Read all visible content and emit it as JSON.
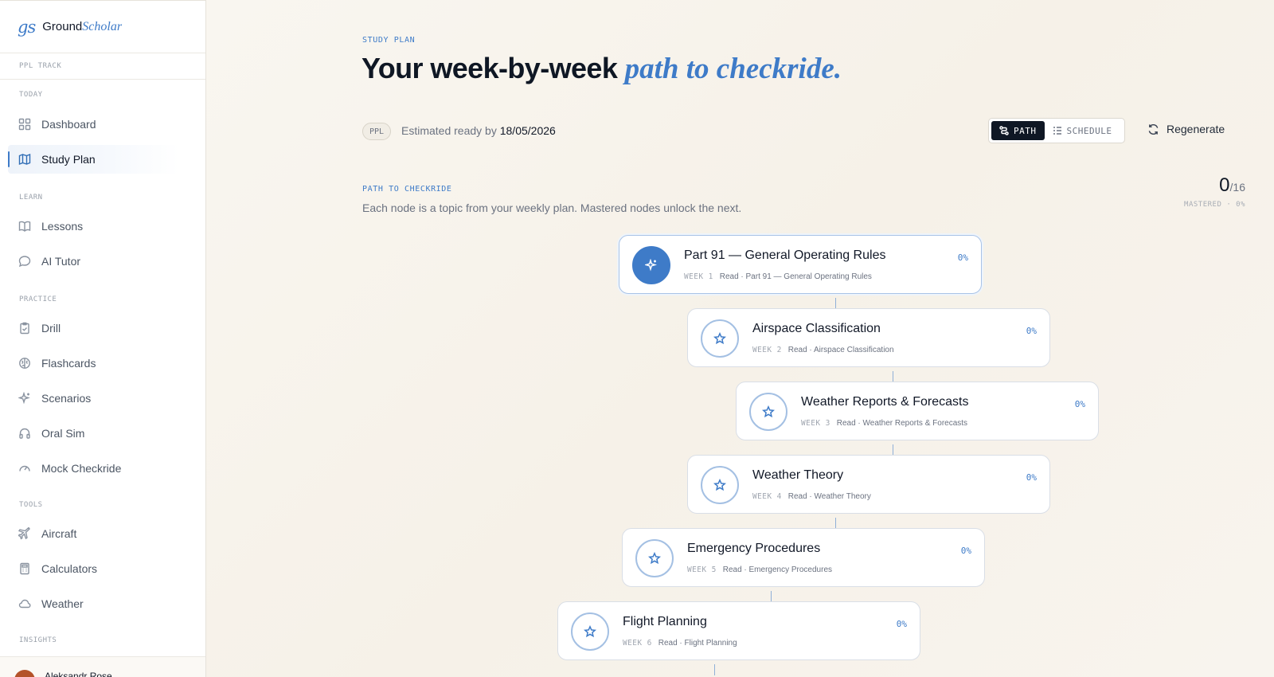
{
  "brand": {
    "mark": "gs",
    "ground": "Ground",
    "scholar": "Scholar"
  },
  "sidebar": {
    "track": "PPL TRACK",
    "sections": {
      "today": "TODAY",
      "learn": "LEARN",
      "practice": "PRACTICE",
      "tools": "TOOLS",
      "insights": "INSIGHTS"
    },
    "items": [
      {
        "label": "Dashboard",
        "icon": "grid-icon"
      },
      {
        "label": "Study Plan",
        "icon": "map-icon",
        "active": true
      },
      {
        "label": "Lessons",
        "icon": "book-icon"
      },
      {
        "label": "AI Tutor",
        "icon": "chat-bubble-icon"
      },
      {
        "label": "Drill",
        "icon": "clipboard-check-icon"
      },
      {
        "label": "Flashcards",
        "icon": "brain-icon"
      },
      {
        "label": "Scenarios",
        "icon": "sparkle-icon"
      },
      {
        "label": "Oral Sim",
        "icon": "headphones-icon"
      },
      {
        "label": "Mock Checkride",
        "icon": "gauge-icon"
      },
      {
        "label": "Aircraft",
        "icon": "plane-icon"
      },
      {
        "label": "Calculators",
        "icon": "calculator-icon"
      },
      {
        "label": "Weather",
        "icon": "cloud-icon"
      }
    ],
    "user": {
      "name": "Aleksandr Rose"
    }
  },
  "header": {
    "eyebrow": "STUDY PLAN",
    "title_main": "Your week-by-week ",
    "title_accent": "path to checkride.",
    "badge": "PPL",
    "estimate_prefix": "Estimated ready by ",
    "estimate_date": "18/05/2026",
    "toggle": {
      "path": "PATH",
      "schedule": "SCHEDULE"
    },
    "regenerate": "Regenerate"
  },
  "path": {
    "eyebrow": "PATH TO CHECKRIDE",
    "subtitle": "Each node is a topic from your weekly plan. Mastered nodes unlock the next.",
    "mastered_count": "0",
    "mastered_total": "/16",
    "mastered_label": "MASTERED · 0%",
    "nodes": [
      {
        "title": "Part 91 — General Operating Rules",
        "week": "WEEK 1",
        "detail": "Read · Part 91 — General Operating Rules",
        "pct": "0%",
        "current": true
      },
      {
        "title": "Airspace Classification",
        "week": "WEEK 2",
        "detail": "Read · Airspace Classification",
        "pct": "0%"
      },
      {
        "title": "Weather Reports & Forecasts",
        "week": "WEEK 3",
        "detail": "Read · Weather Reports & Forecasts",
        "pct": "0%"
      },
      {
        "title": "Weather Theory",
        "week": "WEEK 4",
        "detail": "Read · Weather Theory",
        "pct": "0%"
      },
      {
        "title": "Emergency Procedures",
        "week": "WEEK 5",
        "detail": "Read · Emergency Procedures",
        "pct": "0%"
      },
      {
        "title": "Flight Planning",
        "week": "WEEK 6",
        "detail": "Read · Flight Planning",
        "pct": "0%"
      }
    ]
  }
}
